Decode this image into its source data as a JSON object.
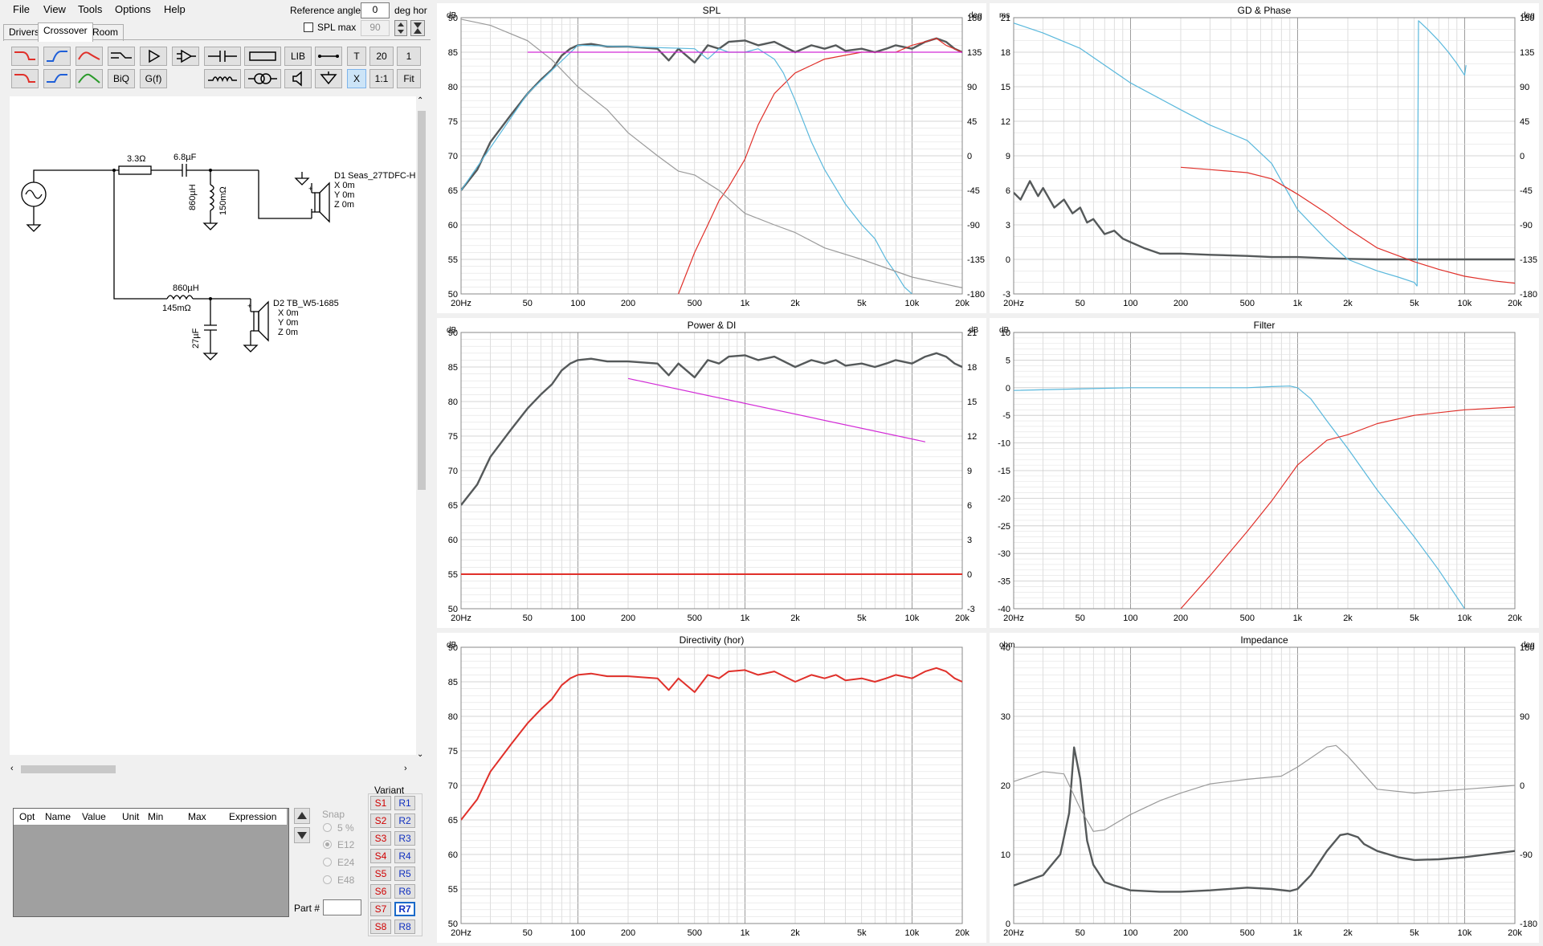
{
  "menu": [
    "File",
    "View",
    "Tools",
    "Options",
    "Help"
  ],
  "tabs": [
    "Drivers",
    "Crossover",
    "Room"
  ],
  "reference": {
    "label": "Reference angle",
    "value": "0",
    "unit": "deg hor",
    "spl_max_label": "SPL max",
    "spl_max_value": "90"
  },
  "toolbar": {
    "row1": [
      "LIB",
      "T",
      "20",
      "1"
    ],
    "row2": [
      "BiQ",
      "G(f)",
      "X",
      "1:1",
      "Fit"
    ]
  },
  "schematic": {
    "r_series": "3.3Ω",
    "c_series": "6.8µF",
    "l_shunt": "860µH",
    "l_shunt_r": "150mΩ",
    "d1_name": "D1 Seas_27TDFC-H",
    "d1_x": "X 0m",
    "d1_y": "Y 0m",
    "d1_z": "Z 0m",
    "l_series": "860µH",
    "l_series_r": "145mΩ",
    "c_shunt": "27µF",
    "d2_name": "D2 TB_W5-1685",
    "d2_x": "X 0m",
    "d2_y": "Y 0m",
    "d2_z": "Z 0m"
  },
  "param_table": {
    "headers": [
      "Opt",
      "Name",
      "Value",
      "Unit",
      "Min",
      "Max",
      "Expression"
    ]
  },
  "snap": {
    "label": "Snap",
    "options": [
      "5 %",
      "E12",
      "E24",
      "E48"
    ],
    "selected": "E12"
  },
  "part_label": "Part #",
  "variant": {
    "label": "Variant",
    "s": [
      "S1",
      "S2",
      "S3",
      "S4",
      "S5",
      "S6",
      "S7",
      "S8"
    ],
    "r": [
      "R1",
      "R2",
      "R3",
      "R4",
      "R5",
      "R6",
      "R7",
      "R8"
    ],
    "active": "R7"
  },
  "colors": {
    "total": "#55595a",
    "tweeter": "#e0302a",
    "woofer": "#5ab8dc",
    "offaxis": "#9a9a9a",
    "target": "#d22ad6",
    "grid": "#c8c8c8"
  },
  "x_ticks": [
    "20Hz",
    "50",
    "100",
    "200",
    "500",
    "1k",
    "2k",
    "5k",
    "10k",
    "20k"
  ],
  "graphs": {
    "spl": {
      "title": "SPL",
      "left_unit": "dB",
      "right_unit": "deg",
      "left_ticks": [
        "90",
        "85",
        "80",
        "75",
        "70",
        "65",
        "60",
        "55",
        "50"
      ],
      "right_ticks": [
        "180",
        "135",
        "90",
        "45",
        "0",
        "-45",
        "-90",
        "-135",
        "-180"
      ]
    },
    "gd": {
      "title": "GD & Phase",
      "left_unit": "ms",
      "right_unit": "deg",
      "left_ticks": [
        "21",
        "18",
        "15",
        "12",
        "9",
        "6",
        "3",
        "0",
        "-3"
      ],
      "right_ticks": [
        "180",
        "135",
        "90",
        "45",
        "0",
        "-45",
        "-90",
        "-135",
        "-180"
      ]
    },
    "power": {
      "title": "Power & DI",
      "left_unit": "dB",
      "right_unit": "dB",
      "left_ticks": [
        "90",
        "85",
        "80",
        "75",
        "70",
        "65",
        "60",
        "55",
        "50"
      ],
      "right_ticks": [
        "21",
        "18",
        "15",
        "12",
        "9",
        "6",
        "3",
        "0",
        "-3"
      ]
    },
    "filter": {
      "title": "Filter",
      "left_unit": "dB",
      "left_ticks": [
        "10",
        "5",
        "0",
        "-5",
        "-10",
        "-15",
        "-20",
        "-25",
        "-30",
        "-35",
        "-40"
      ]
    },
    "directivity": {
      "title": "Directivity (hor)",
      "left_unit": "dB",
      "left_ticks": [
        "90",
        "85",
        "80",
        "75",
        "70",
        "65",
        "60",
        "55",
        "50"
      ]
    },
    "impedance": {
      "title": "Impedance",
      "left_unit": "ohm",
      "right_unit": "deg",
      "left_ticks": [
        "40",
        "30",
        "20",
        "10",
        "0"
      ],
      "right_ticks": [
        "180",
        "90",
        "0",
        "-90",
        "-180"
      ]
    }
  },
  "chart_data": [
    {
      "type": "line",
      "title": "SPL",
      "xlabel": "",
      "ylabel": "dB",
      "xscale": "log",
      "xlim": [
        20,
        20000
      ],
      "ylim": [
        50,
        90
      ],
      "y2lim": [
        -180,
        180
      ],
      "grid": true,
      "series": [
        {
          "color": "#55595a",
          "x": [
            20,
            25,
            30,
            40,
            50,
            60,
            70,
            80,
            90,
            100,
            120,
            150,
            200,
            300,
            350,
            400,
            500,
            600,
            700,
            800,
            1000,
            1200,
            1500,
            2000,
            2500,
            3000,
            3500,
            4000,
            5000,
            6000,
            7000,
            8000,
            10000,
            12000,
            14000,
            16000,
            18000,
            20000
          ],
          "y": [
            65,
            68,
            72,
            76,
            79,
            81,
            82.5,
            84.5,
            85.5,
            86,
            86.2,
            85.8,
            85.8,
            85.5,
            83.8,
            85.5,
            83.5,
            86,
            85.5,
            86.5,
            86.7,
            86,
            86.5,
            85,
            86,
            85.5,
            86,
            85.2,
            85.5,
            85,
            85.5,
            86,
            85.5,
            86.5,
            87,
            86.5,
            85.5,
            85
          ]
        },
        {
          "color": "#e0302a",
          "x": [
            400,
            500,
            600,
            700,
            800,
            1000,
            1200,
            1500,
            2000,
            3000,
            5000,
            8000,
            10000,
            12000,
            14000,
            16000,
            20000
          ],
          "y": [
            50,
            56,
            60,
            63.5,
            65.5,
            69.5,
            74.5,
            79,
            82,
            84,
            85,
            85,
            86,
            86.5,
            87,
            86,
            85
          ]
        },
        {
          "color": "#5ab8dc",
          "x": [
            20,
            50,
            100,
            200,
            500,
            600,
            700,
            800,
            1000,
            1200,
            1500,
            1700,
            2000,
            2500,
            3000,
            4000,
            5000,
            6000,
            7000,
            8000,
            9000,
            10000
          ],
          "y": [
            65,
            79,
            86,
            85.8,
            85.5,
            84,
            85.5,
            85,
            85,
            85.5,
            84,
            82,
            78,
            72,
            68,
            63,
            60,
            58,
            55,
            53,
            51,
            50
          ]
        },
        {
          "color": "#9a9a9a",
          "axis": "phase",
          "x": [
            20,
            30,
            50,
            70,
            100,
            150,
            200,
            300,
            400,
            500,
            700,
            1000,
            1500,
            2000,
            3000,
            5000,
            10000,
            20000
          ],
          "y": [
            178,
            170,
            150,
            125,
            90,
            60,
            30,
            0,
            -20,
            -25,
            -45,
            -75,
            -90,
            -100,
            -120,
            -135,
            -158,
            -172
          ]
        },
        {
          "color": "#d22ad6",
          "x": [
            50,
            20000
          ],
          "y": [
            85,
            85
          ]
        }
      ]
    },
    {
      "type": "line",
      "title": "GD & Phase",
      "xlabel": "",
      "ylabel": "ms",
      "xscale": "log",
      "xlim": [
        20,
        20000
      ],
      "ylim": [
        -3,
        21
      ],
      "y2lim": [
        -180,
        180
      ],
      "grid": true,
      "series": [
        {
          "color": "#55595a",
          "x": [
            20,
            22,
            25,
            28,
            30,
            35,
            40,
            45,
            50,
            55,
            60,
            70,
            80,
            90,
            100,
            120,
            150,
            200,
            300,
            500,
            700,
            1000,
            1500,
            2000,
            3000,
            5000,
            10000,
            20000
          ],
          "y": [
            5.8,
            5.2,
            6.8,
            5.5,
            6.2,
            4.5,
            5.2,
            4,
            4.5,
            3.2,
            3.5,
            2.2,
            2.5,
            1.8,
            1.5,
            1,
            0.5,
            0.5,
            0.4,
            0.3,
            0.2,
            0.2,
            0.1,
            0.05,
            0,
            0,
            0,
            0
          ]
        },
        {
          "color": "#5ab8dc",
          "axis": "phase",
          "x": [
            20,
            30,
            50,
            100,
            200,
            300,
            500,
            700,
            1000,
            1500,
            2000,
            3000,
            4000,
            5000,
            5200
          ],
          "y": [
            173,
            160,
            140,
            95,
            60,
            40,
            20,
            -10,
            -70,
            -110,
            -135,
            -150,
            -158,
            -165,
            -170
          ]
        },
        {
          "color": "#5ab8dc",
          "axis": "phase",
          "x": [
            5200,
            5300,
            6000,
            7000,
            8000,
            9000,
            10000,
            10200
          ],
          "y": [
            -170,
            176,
            165,
            150,
            135,
            120,
            105,
            118
          ]
        },
        {
          "color": "#e0302a",
          "axis": "phase",
          "x": [
            200,
            300,
            500,
            700,
            1000,
            1500,
            2000,
            3000,
            5000,
            7000,
            10000,
            15000,
            20000
          ],
          "y": [
            -15,
            -18,
            -22,
            -30,
            -50,
            -75,
            -95,
            -120,
            -138,
            -148,
            -157,
            -163,
            -166
          ]
        }
      ]
    },
    {
      "type": "line",
      "title": "Power & DI",
      "xlabel": "",
      "ylabel": "dB",
      "xscale": "log",
      "xlim": [
        20,
        20000
      ],
      "ylim": [
        50,
        90
      ],
      "y2lim": [
        -3,
        21
      ],
      "grid": true,
      "series": [
        {
          "color": "#55595a",
          "x": [
            20,
            25,
            30,
            40,
            50,
            60,
            70,
            80,
            90,
            100,
            120,
            150,
            200,
            300,
            350,
            400,
            500,
            600,
            700,
            800,
            1000,
            1200,
            1500,
            2000,
            2500,
            3000,
            3500,
            4000,
            5000,
            6000,
            7000,
            8000,
            10000,
            12000,
            14000,
            16000,
            18000,
            20000
          ],
          "y": [
            65,
            68,
            72,
            76,
            79,
            81,
            82.5,
            84.5,
            85.5,
            86,
            86.2,
            85.8,
            85.8,
            85.5,
            83.8,
            85.5,
            83.5,
            86,
            85.5,
            86.5,
            86.7,
            86,
            86.5,
            85,
            86,
            85.5,
            86,
            85.2,
            85.5,
            85,
            85.5,
            86,
            85.5,
            86.5,
            87,
            86.5,
            85.5,
            85
          ]
        },
        {
          "color": "#d22ad6",
          "axis": "di",
          "x": [
            200,
            12000
          ],
          "y": [
            17,
            11.5
          ]
        },
        {
          "color": "#e0302a",
          "axis": "di",
          "x": [
            20,
            20000
          ],
          "y": [
            0,
            0
          ]
        }
      ]
    },
    {
      "type": "line",
      "title": "Filter",
      "xlabel": "",
      "ylabel": "dB",
      "xscale": "log",
      "xlim": [
        20,
        20000
      ],
      "ylim": [
        -40,
        10
      ],
      "grid": true,
      "series": [
        {
          "color": "#5ab8dc",
          "x": [
            20,
            100,
            200,
            500,
            700,
            900,
            1000,
            1200,
            1500,
            2000,
            3000,
            5000,
            7000,
            10000
          ],
          "y": [
            -0.5,
            0,
            0,
            0,
            0.2,
            0.3,
            0,
            -2,
            -6,
            -11,
            -18.5,
            -27,
            -33,
            -40
          ]
        },
        {
          "color": "#e0302a",
          "x": [
            200,
            300,
            500,
            700,
            1000,
            1500,
            2000,
            3000,
            5000,
            10000,
            20000
          ],
          "y": [
            -40,
            -34,
            -26,
            -20.5,
            -14,
            -9.5,
            -8.5,
            -6.5,
            -5,
            -4,
            -3.5
          ]
        }
      ]
    },
    {
      "type": "line",
      "title": "Directivity (hor)",
      "xlabel": "",
      "ylabel": "dB",
      "xscale": "log",
      "xlim": [
        20,
        20000
      ],
      "ylim": [
        50,
        90
      ],
      "grid": true,
      "series": [
        {
          "color": "#e0302a",
          "x": [
            20,
            25,
            30,
            40,
            50,
            60,
            70,
            80,
            90,
            100,
            120,
            150,
            200,
            300,
            350,
            400,
            500,
            600,
            700,
            800,
            1000,
            1200,
            1500,
            2000,
            2500,
            3000,
            3500,
            4000,
            5000,
            6000,
            7000,
            8000,
            10000,
            12000,
            14000,
            16000,
            18000,
            20000
          ],
          "y": [
            65,
            68,
            72,
            76,
            79,
            81,
            82.5,
            84.5,
            85.5,
            86,
            86.2,
            85.8,
            85.8,
            85.5,
            83.8,
            85.5,
            83.5,
            86,
            85.5,
            86.5,
            86.7,
            86,
            86.5,
            85,
            86,
            85.5,
            86,
            85.2,
            85.5,
            85,
            85.5,
            86,
            85.5,
            86.5,
            87,
            86.5,
            85.5,
            85
          ]
        }
      ]
    },
    {
      "type": "line",
      "title": "Impedance",
      "xlabel": "",
      "ylabel": "ohm",
      "xscale": "log",
      "xlim": [
        20,
        20000
      ],
      "ylim": [
        0,
        40
      ],
      "y2lim": [
        -180,
        180
      ],
      "grid": true,
      "series": [
        {
          "color": "#55595a",
          "x": [
            20,
            30,
            38,
            43,
            46,
            50,
            55,
            60,
            70,
            80,
            100,
            150,
            200,
            300,
            500,
            700,
            900,
            1000,
            1200,
            1500,
            1800,
            2000,
            2300,
            2500,
            3000,
            4000,
            5000,
            7000,
            10000,
            20000
          ],
          "y": [
            5.5,
            7,
            10,
            16,
            25.5,
            21,
            12,
            8.5,
            6,
            5.5,
            4.8,
            4.6,
            4.6,
            4.8,
            5.2,
            5,
            4.7,
            5,
            7,
            10.5,
            12.8,
            13,
            12.5,
            11.5,
            10.5,
            9.6,
            9.2,
            9.3,
            9.6,
            10.5
          ]
        },
        {
          "color": "#9a9a9a",
          "axis": "phase",
          "x": [
            20,
            30,
            40,
            50,
            60,
            70,
            100,
            150,
            200,
            300,
            500,
            800,
            1000,
            1500,
            1700,
            2000,
            3000,
            5000,
            10000,
            20000
          ],
          "y": [
            5,
            18,
            15,
            -30,
            -60,
            -58,
            -38,
            -20,
            -10,
            2,
            8,
            12,
            24,
            50,
            52,
            38,
            -5,
            -10,
            -5,
            0
          ]
        }
      ]
    }
  ]
}
